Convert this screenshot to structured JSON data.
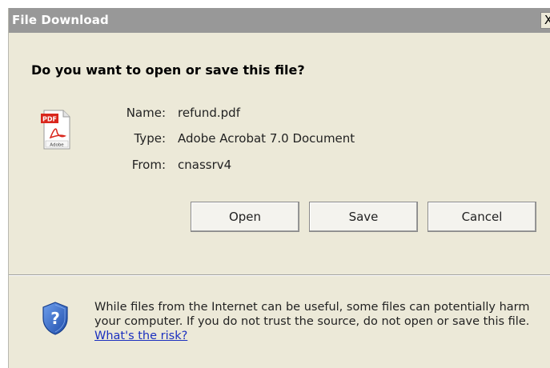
{
  "window": {
    "title": "File Download",
    "close_label": "X"
  },
  "dialog": {
    "question": "Do you want to open or save this file?",
    "file": {
      "name_label": "Name:",
      "name_value": "refund.pdf",
      "type_label": "Type:",
      "type_value": "Adobe Acrobat 7.0 Document",
      "from_label": "From:",
      "from_value": "cnassrv4"
    },
    "icon": {
      "name": "pdf-file-icon",
      "badge_text": "PDF",
      "brand_text": "Adobe"
    },
    "buttons": {
      "open": "Open",
      "save": "Save",
      "cancel": "Cancel"
    },
    "warning": {
      "icon": "shield-question-icon",
      "text": "While files from the Internet can be useful, some files can potentially harm your computer. If you do not trust the source, do not open or save this file.",
      "link": "What's the risk?"
    }
  },
  "colors": {
    "dialog_bg": "#ece9d8",
    "titlebar_bg": "#989898",
    "link": "#1a2fbf",
    "pdf_red": "#d9261c",
    "shield_blue": "#2a64c5"
  }
}
